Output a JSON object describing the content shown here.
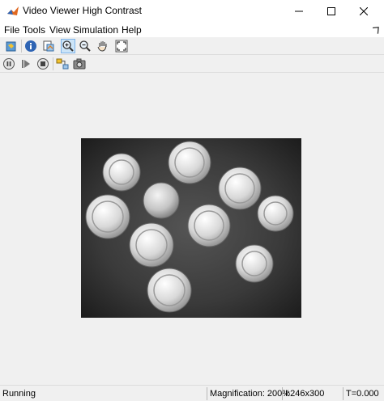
{
  "window": {
    "title": "Video Viewer High Contrast",
    "app_icon": "matlab-icon",
    "controls": [
      "minimize-icon",
      "maximize-icon",
      "close-icon"
    ]
  },
  "menu": {
    "items": [
      "File",
      "Tools",
      "View",
      "Simulation",
      "Help"
    ]
  },
  "toolbar1": {
    "icons": [
      "open-model-icon",
      "info-icon",
      "export-icon",
      "zoom-in-icon",
      "zoom-out-icon",
      "pan-hand-icon",
      "fit-to-view-icon"
    ],
    "active": "zoom-in-icon"
  },
  "toolbar2": {
    "icons": [
      "pause-icon",
      "step-forward-icon",
      "stop-icon",
      "highlight-model-icon",
      "snapshot-icon"
    ]
  },
  "status": {
    "state": "Running",
    "magnification": "Magnification: 200%",
    "image_info": "I:246x300",
    "time": "T=0.000"
  },
  "colors": {
    "titlebar_bg": "#ffffff",
    "chrome_bg": "#f0f0f0",
    "active_tool_bg": "#cce4f7",
    "video_bg": "#2a2a2a"
  }
}
